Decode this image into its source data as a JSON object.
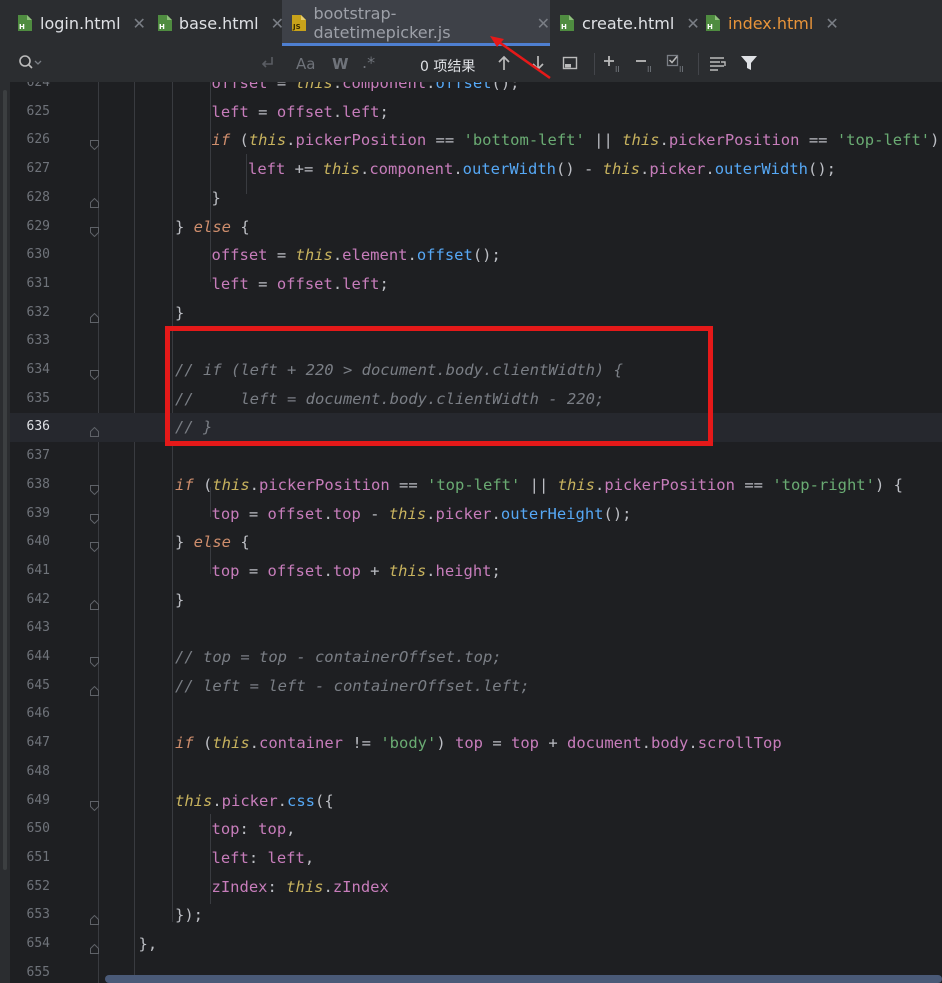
{
  "tabs": [
    {
      "label": "login.html",
      "icon": "html-file-icon",
      "badge": "H",
      "active": false
    },
    {
      "label": "base.html",
      "icon": "html-file-icon",
      "badge": "H",
      "active": false
    },
    {
      "label": "bootstrap-datetimepicker.js",
      "icon": "js-file-icon",
      "badge": "JS",
      "active": true
    },
    {
      "label": "create.html",
      "icon": "html-file-icon",
      "badge": "H",
      "active": false
    },
    {
      "label": "index.html",
      "icon": "html-file-icon",
      "badge": "H",
      "active": false
    }
  ],
  "findbar": {
    "search_icon": "search-icon",
    "match_case": "Aa",
    "whole_words": "W",
    "regex": ".*",
    "result_count": "0 项结果"
  },
  "editor": {
    "current_line": "636",
    "lines": [
      {
        "num": "624",
        "text": "offset = this.component.offset();"
      },
      {
        "num": "625",
        "text": "left = offset.left;"
      },
      {
        "num": "626",
        "text": "if (this.pickerPosition == 'bottom-left' || this.pickerPosition == 'top-left')"
      },
      {
        "num": "627",
        "text": "left += this.component.outerWidth() - this.picker.outerWidth();"
      },
      {
        "num": "628",
        "text": "}"
      },
      {
        "num": "629",
        "text": "} else {"
      },
      {
        "num": "630",
        "text": "offset = this.element.offset();"
      },
      {
        "num": "631",
        "text": "left = offset.left;"
      },
      {
        "num": "632",
        "text": "}"
      },
      {
        "num": "633",
        "text": ""
      },
      {
        "num": "634",
        "text": "// if (left + 220 > document.body.clientWidth) {"
      },
      {
        "num": "635",
        "text": "//     left = document.body.clientWidth - 220;"
      },
      {
        "num": "636",
        "text": "// }"
      },
      {
        "num": "637",
        "text": ""
      },
      {
        "num": "638",
        "text": "if (this.pickerPosition == 'top-left' || this.pickerPosition == 'top-right') {"
      },
      {
        "num": "639",
        "text": "top = offset.top - this.picker.outerHeight();"
      },
      {
        "num": "640",
        "text": "} else {"
      },
      {
        "num": "641",
        "text": "top = offset.top + this.height;"
      },
      {
        "num": "642",
        "text": "}"
      },
      {
        "num": "643",
        "text": ""
      },
      {
        "num": "644",
        "text": "// top = top - containerOffset.top;"
      },
      {
        "num": "645",
        "text": "// left = left - containerOffset.left;"
      },
      {
        "num": "646",
        "text": ""
      },
      {
        "num": "647",
        "text": "if (this.container != 'body') top = top + document.body.scrollTop"
      },
      {
        "num": "648",
        "text": ""
      },
      {
        "num": "649",
        "text": "this.picker.css({"
      },
      {
        "num": "650",
        "text": "top: top,"
      },
      {
        "num": "651",
        "text": "left: left,"
      },
      {
        "num": "652",
        "text": "zIndex: this.zIndex"
      },
      {
        "num": "653",
        "text": "});"
      },
      {
        "num": "654",
        "text": "},"
      },
      {
        "num": "655",
        "text": ""
      }
    ]
  },
  "colors": {
    "highlight_box": "#e51919",
    "active_tab_underline": "#4e7fd1",
    "keyword": "#cf8e6d",
    "string": "#6aab73",
    "comment": "#7a7e85",
    "field": "#c77dbb"
  }
}
